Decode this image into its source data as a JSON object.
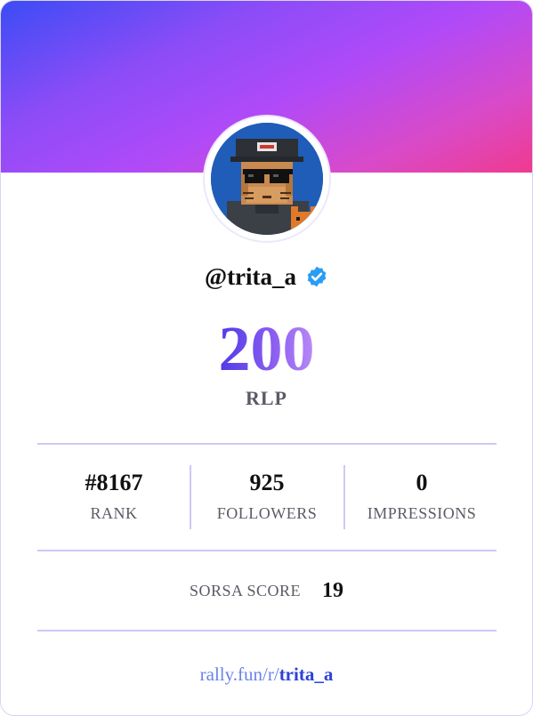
{
  "profile": {
    "handle": "@trita_a",
    "verified": true,
    "avatar_icon": "pixel-cat-avatar"
  },
  "score": {
    "value": "200",
    "unit": "RLP"
  },
  "stats": [
    {
      "value": "#8167",
      "label": "RANK"
    },
    {
      "value": "925",
      "label": "FOLLOWERS"
    },
    {
      "value": "0",
      "label": "IMPRESSIONS"
    }
  ],
  "sorsa": {
    "label": "SORSA SCORE",
    "value": "19"
  },
  "link": {
    "prefix": "rally.fun/r/",
    "username": "trita_a"
  },
  "colors": {
    "banner_start": "#3b4cf5",
    "banner_mid": "#b04af8",
    "banner_end": "#f03a8e",
    "score_gradient_start": "#4f3be6",
    "score_gradient_end": "#b98af7",
    "divider": "#cfc7f6",
    "verified_badge": "#2a9df4",
    "link_prefix": "#6c82ea",
    "link_user": "#2b43d6"
  }
}
